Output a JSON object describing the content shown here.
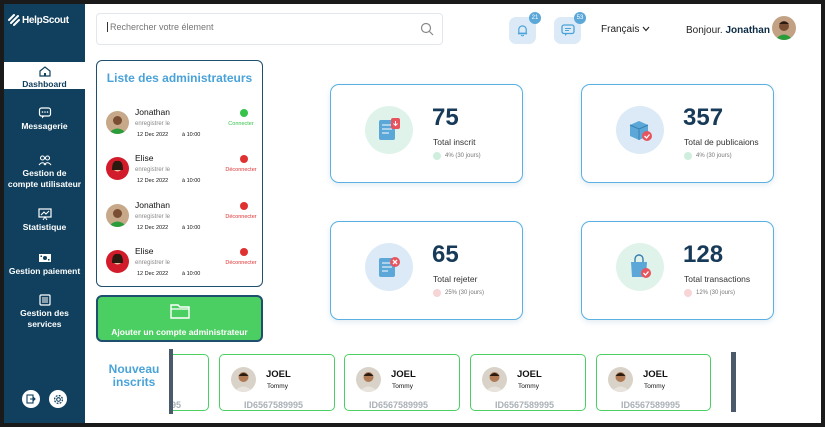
{
  "brand": {
    "name": "HelpScout"
  },
  "sidebar": {
    "items": [
      {
        "label": "Dashboard",
        "icon": "home-icon",
        "active": true
      },
      {
        "label": "Messagerie",
        "icon": "chat-icon"
      },
      {
        "label": "Gestion de compte utilisateur",
        "icon": "users-icon"
      },
      {
        "label": "Statistique",
        "icon": "chart-icon"
      },
      {
        "label": "Gestion paiement",
        "icon": "money-icon"
      },
      {
        "label": "Gestion des services",
        "icon": "list-icon"
      }
    ],
    "bottom_icons": [
      "logout-icon",
      "settings-icon"
    ]
  },
  "header": {
    "search_placeholder": "Rechercher votre élement",
    "notifications_count": "21",
    "messages_count": "53",
    "language": "Français",
    "greeting_prefix": "Bonjour.",
    "user_name": "Jonathan"
  },
  "admins": {
    "title": "Liste des administrateurs",
    "items": [
      {
        "name": "Jonathan",
        "sub": "enregistrer le",
        "date": "12 Dec 2022",
        "time": "à 10:00",
        "status": "Connecter",
        "status_color": "#36c24b"
      },
      {
        "name": "Elise",
        "sub": "enregistrer le",
        "date": "12 Dec 2022",
        "time": "à 10:00",
        "status": "Déconnecter",
        "status_color": "#e03131"
      },
      {
        "name": "Jonathan",
        "sub": "enregistrer le",
        "date": "12 Dec 2022",
        "time": "à 10:00",
        "status": "Déconnecter",
        "status_color": "#e03131"
      },
      {
        "name": "Elise",
        "sub": "enregistrer le",
        "date": "12 Dec 2022",
        "time": "à 10:00",
        "status": "Déconnecter",
        "status_color": "#e03131"
      }
    ],
    "add_button": "Ajouter un compte administrateur"
  },
  "stats": [
    {
      "value": "75",
      "label": "Total inscrit",
      "change": "4% (30 jours)",
      "trend": "up",
      "icon": "document-icon",
      "bubble": "#dff3ea"
    },
    {
      "value": "357",
      "label": "Total de publicaions",
      "change": "4% (30 jours)",
      "trend": "up",
      "icon": "package-icon",
      "bubble": "#dbeaf6"
    },
    {
      "value": "65",
      "label": "Total rejeter",
      "change": "25% (30 jours)",
      "trend": "down",
      "icon": "rejected-document-icon",
      "bubble": "#dbeaf6"
    },
    {
      "value": "128",
      "label": "Total transactions",
      "change": "12% (30 jours)",
      "trend": "down",
      "icon": "shopping-bag-icon",
      "bubble": "#dff3ea"
    }
  ],
  "new_signups": {
    "title": "Nouveau inscrits",
    "partial_id": "95",
    "items": [
      {
        "name": "JOEL",
        "sub": "Tommy",
        "id": "ID6567589995"
      },
      {
        "name": "JOEL",
        "sub": "Tommy",
        "id": "ID6567589995"
      },
      {
        "name": "JOEL",
        "sub": "Tommy",
        "id": "ID6567589995"
      },
      {
        "name": "JOEL",
        "sub": "Tommy",
        "id": "ID6567589995"
      }
    ]
  },
  "colors": {
    "sidebar": "#10405e",
    "accent": "#4aa3d8",
    "success": "#4ccf62",
    "danger": "#e03131"
  }
}
